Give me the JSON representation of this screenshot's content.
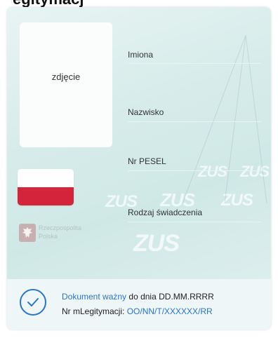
{
  "heading": "egitymacj",
  "photo": {
    "label": "zdjęcie"
  },
  "fields": [
    {
      "label": "Imiona"
    },
    {
      "label": "Nazwisko"
    },
    {
      "label": "Nr PESEL"
    },
    {
      "label": "Rodzaj świadczenia"
    }
  ],
  "watermark": {
    "text": "ZUS"
  },
  "emblem": {
    "text_line1": "Rzeczpospolita",
    "text_line2": "Polska"
  },
  "status": {
    "word_document": "Dokument",
    "word_valid": "ważny",
    "until_text": "do dnia DD.MM.RRRR",
    "number_label": "Nr mLegitymacji:",
    "number_value": "OO/NN/T/XXXXXX/RR"
  },
  "colors": {
    "accent": "#2a76c9",
    "flag_red": "#d4243b"
  },
  "icons": {
    "status": "check-circle-icon",
    "emblem": "eagle-emblem-icon"
  }
}
